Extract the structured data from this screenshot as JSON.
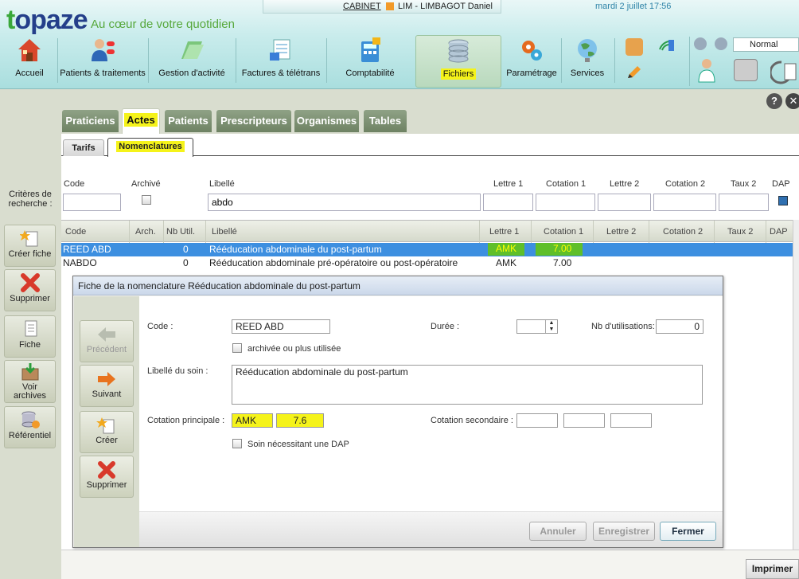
{
  "app": {
    "brand": "topaze",
    "slogan": "Au cœur de votre quotidien",
    "cabinet_label": "CABINET",
    "user": "LIM - LIMBAGOT Daniel",
    "datetime": "mardi 2 juillet 17:56",
    "zoom": "Normal"
  },
  "nav": [
    {
      "label": "Accueil",
      "icon": "house-icon"
    },
    {
      "label": "Patients & traitements",
      "icon": "patients-icon"
    },
    {
      "label": "Gestion d'activité",
      "icon": "folder-icon"
    },
    {
      "label": "Factures & télétrans",
      "icon": "invoice-icon"
    },
    {
      "label": "Comptabilité",
      "icon": "calculator-icon"
    },
    {
      "label": "Fichiers",
      "icon": "database-icon"
    },
    {
      "label": "Paramétrage",
      "icon": "gears-icon"
    },
    {
      "label": "Services",
      "icon": "globe-icon"
    }
  ],
  "tabs": [
    "Praticiens",
    "Actes",
    "Patients",
    "Prescripteurs",
    "Organismes",
    "Tables"
  ],
  "subtabs": [
    "Tarifs",
    "Nomenclatures"
  ],
  "criteria_label": "Critères de recherche :",
  "search": {
    "labels": [
      "Code",
      "Archivé",
      "Libellé",
      "Lettre 1",
      "Cotation 1",
      "Lettre 2",
      "Cotation 2",
      "Taux 2",
      "DAP"
    ],
    "libelle_value": "abdo"
  },
  "sidebar": [
    "Créer fiche",
    "Supprimer",
    "Fiche",
    "Voir archives",
    "Référentiel"
  ],
  "grid": {
    "headers": [
      "Code",
      "Arch.",
      "Nb Util.",
      "Libellé",
      "Lettre 1",
      "Cotation 1",
      "Lettre 2",
      "Cotation 2",
      "Taux 2",
      "DAP"
    ],
    "rows": [
      {
        "code": "REED ABD",
        "nb": "0",
        "libelle": "Rééducation abdominale du post-partum",
        "lettre1": "AMK",
        "cotation1": "7.00"
      },
      {
        "code": "NABDO",
        "nb": "0",
        "libelle": "Rééducation abdominale pré-opératoire ou post-opératoire",
        "lettre1": "AMK",
        "cotation1": "7.00"
      }
    ]
  },
  "dialog": {
    "title": "Fiche de la nomenclature Rééducation abdominale du post-partum",
    "side": [
      "Précédent",
      "Suivant",
      "Créer",
      "Supprimer"
    ],
    "code_label": "Code :",
    "code_value": "REED ABD",
    "duree_label": "Durée :",
    "nbutil_label": "Nb d'utilisations:",
    "nbutil_value": "0",
    "archived_label": "archivée ou plus utilisée",
    "libelle_label": "Libellé du soin :",
    "libelle_value": "Rééducation abdominale du post-partum",
    "cot_principale_label": "Cotation principale :",
    "cot_lettre": "AMK",
    "cot_valeur": "7.6",
    "cot_secondaire_label": "Cotation secondaire :",
    "dap_label": "Soin nécessitant une DAP",
    "buttons": [
      "Annuler",
      "Enregistrer",
      "Fermer"
    ]
  },
  "print_label": "Imprimer"
}
